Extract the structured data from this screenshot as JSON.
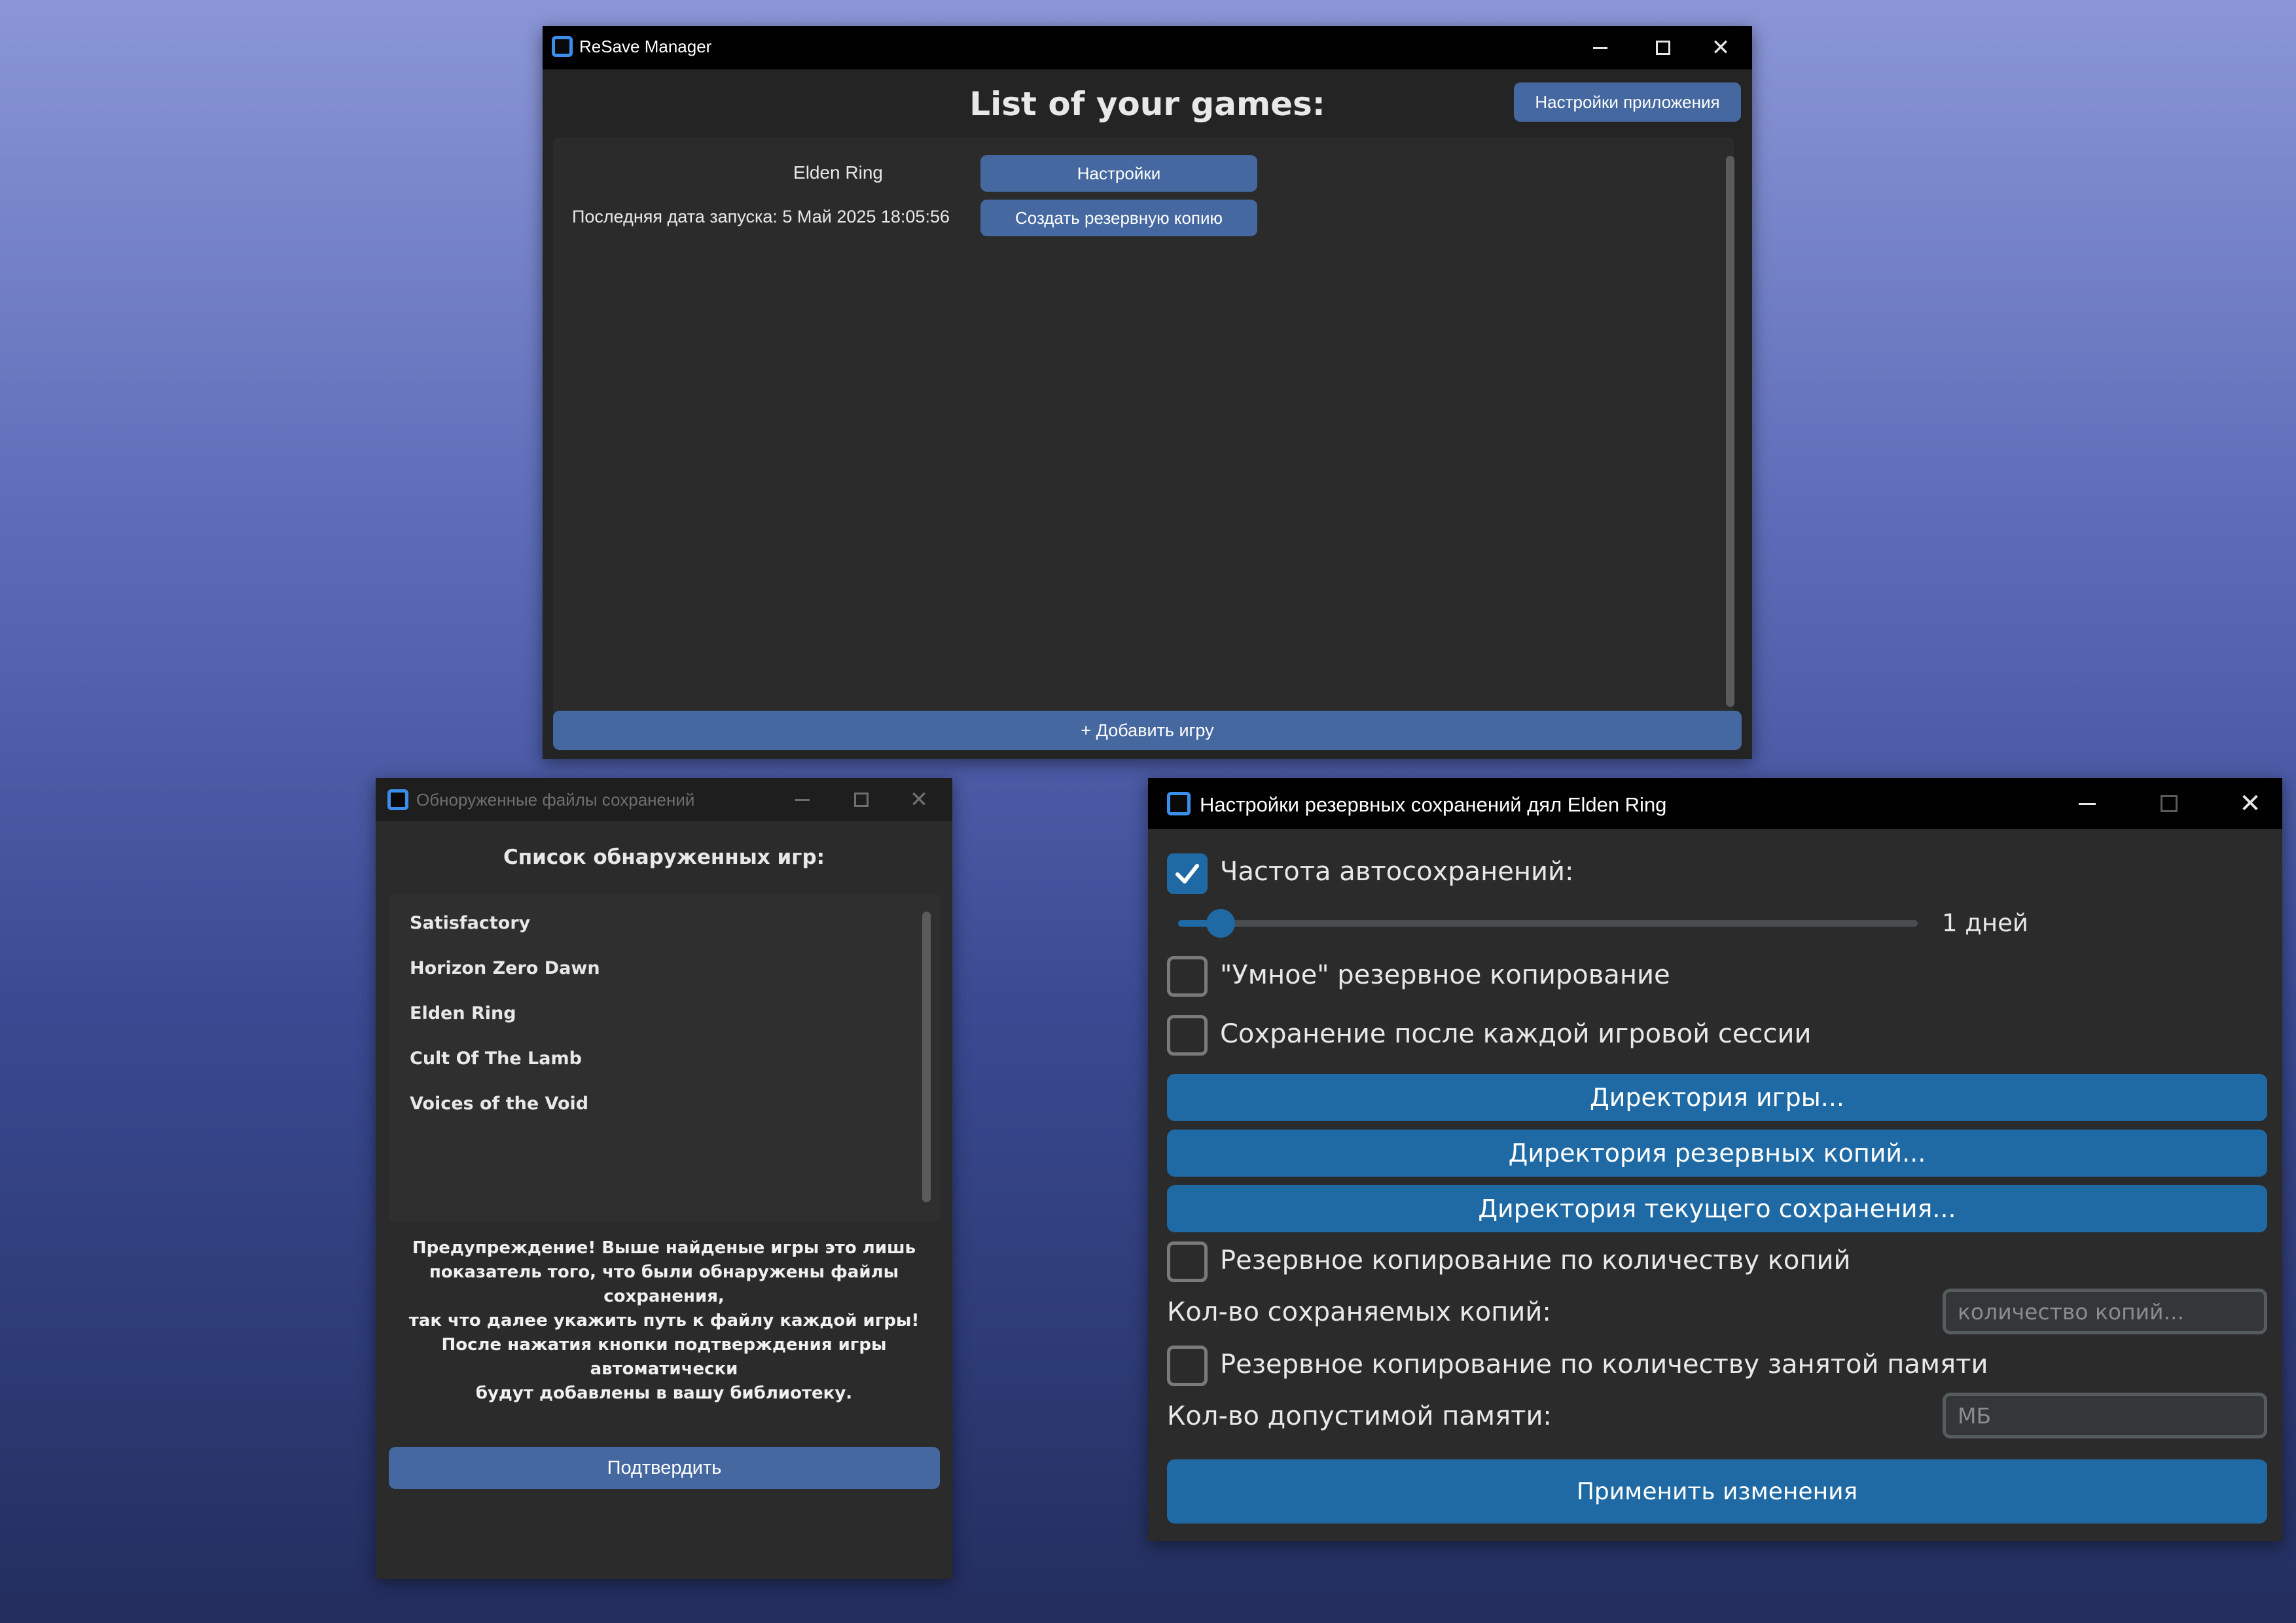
{
  "main_window": {
    "title": "ReSave Manager",
    "heading": "List of your games:",
    "app_settings_button": "Настройки приложения",
    "games": [
      {
        "name": "Elden Ring",
        "last_launch": "Последняя дата запуска: 5 Май 2025 18:05:56",
        "settings_button": "Настройки",
        "backup_button": "Создать резервную копию"
      }
    ],
    "add_game_button": "+ Добавить игру"
  },
  "detected_window": {
    "title": "Обноруженные файлы сохранений",
    "heading": "Список обнаруженных игр:",
    "games": [
      "Satisfactory",
      "Horizon Zero Dawn",
      "Elden Ring",
      "Cult Of The Lamb",
      "Voices of the Void"
    ],
    "warning_lines": [
      "Предупреждение! Выше найденые игры это лишь",
      "показатель того, что были обнаружены файлы сохранения,",
      "так что далее укажить путь к файлу каждой игры!",
      "После нажатия кнопки подтверждения игры автоматически",
      "будут добавлены в вашу библиотеку."
    ],
    "confirm_button": "Подтвердить"
  },
  "settings_window": {
    "title": "Настройки резервных сохранений дял Elden Ring",
    "autosave_label": "Частота автосохранений:",
    "autosave_checked": true,
    "slider_value_label": "1 дней",
    "slider_fraction": 0.04,
    "smart_backup_label": "\"Умное\" резервное копирование",
    "smart_backup_checked": false,
    "session_backup_label": "Сохранение после каждой игровой сессии",
    "session_backup_checked": false,
    "game_dir_button": "Директория игры...",
    "backup_dir_button": "Директория резервных копий...",
    "current_save_dir_button": "Директория текущего сохранения...",
    "count_backup_label": "Резервное копирование по количеству копий",
    "count_backup_checked": false,
    "copies_count_label": "Кол-во сохраняемых копий:",
    "copies_count_placeholder": "количество копий...",
    "memory_backup_label": "Резервное копирование по количеству занятой памяти",
    "memory_backup_checked": false,
    "memory_limit_label": "Кол-во допустимой памяти:",
    "memory_limit_placeholder": "МБ",
    "apply_button": "Применить изменения"
  },
  "colors": {
    "accent_blue": "#1f6aa5",
    "slate_button": "#44689f",
    "window_bg": "#2b2b2b",
    "titlebar_bg": "#000000"
  }
}
